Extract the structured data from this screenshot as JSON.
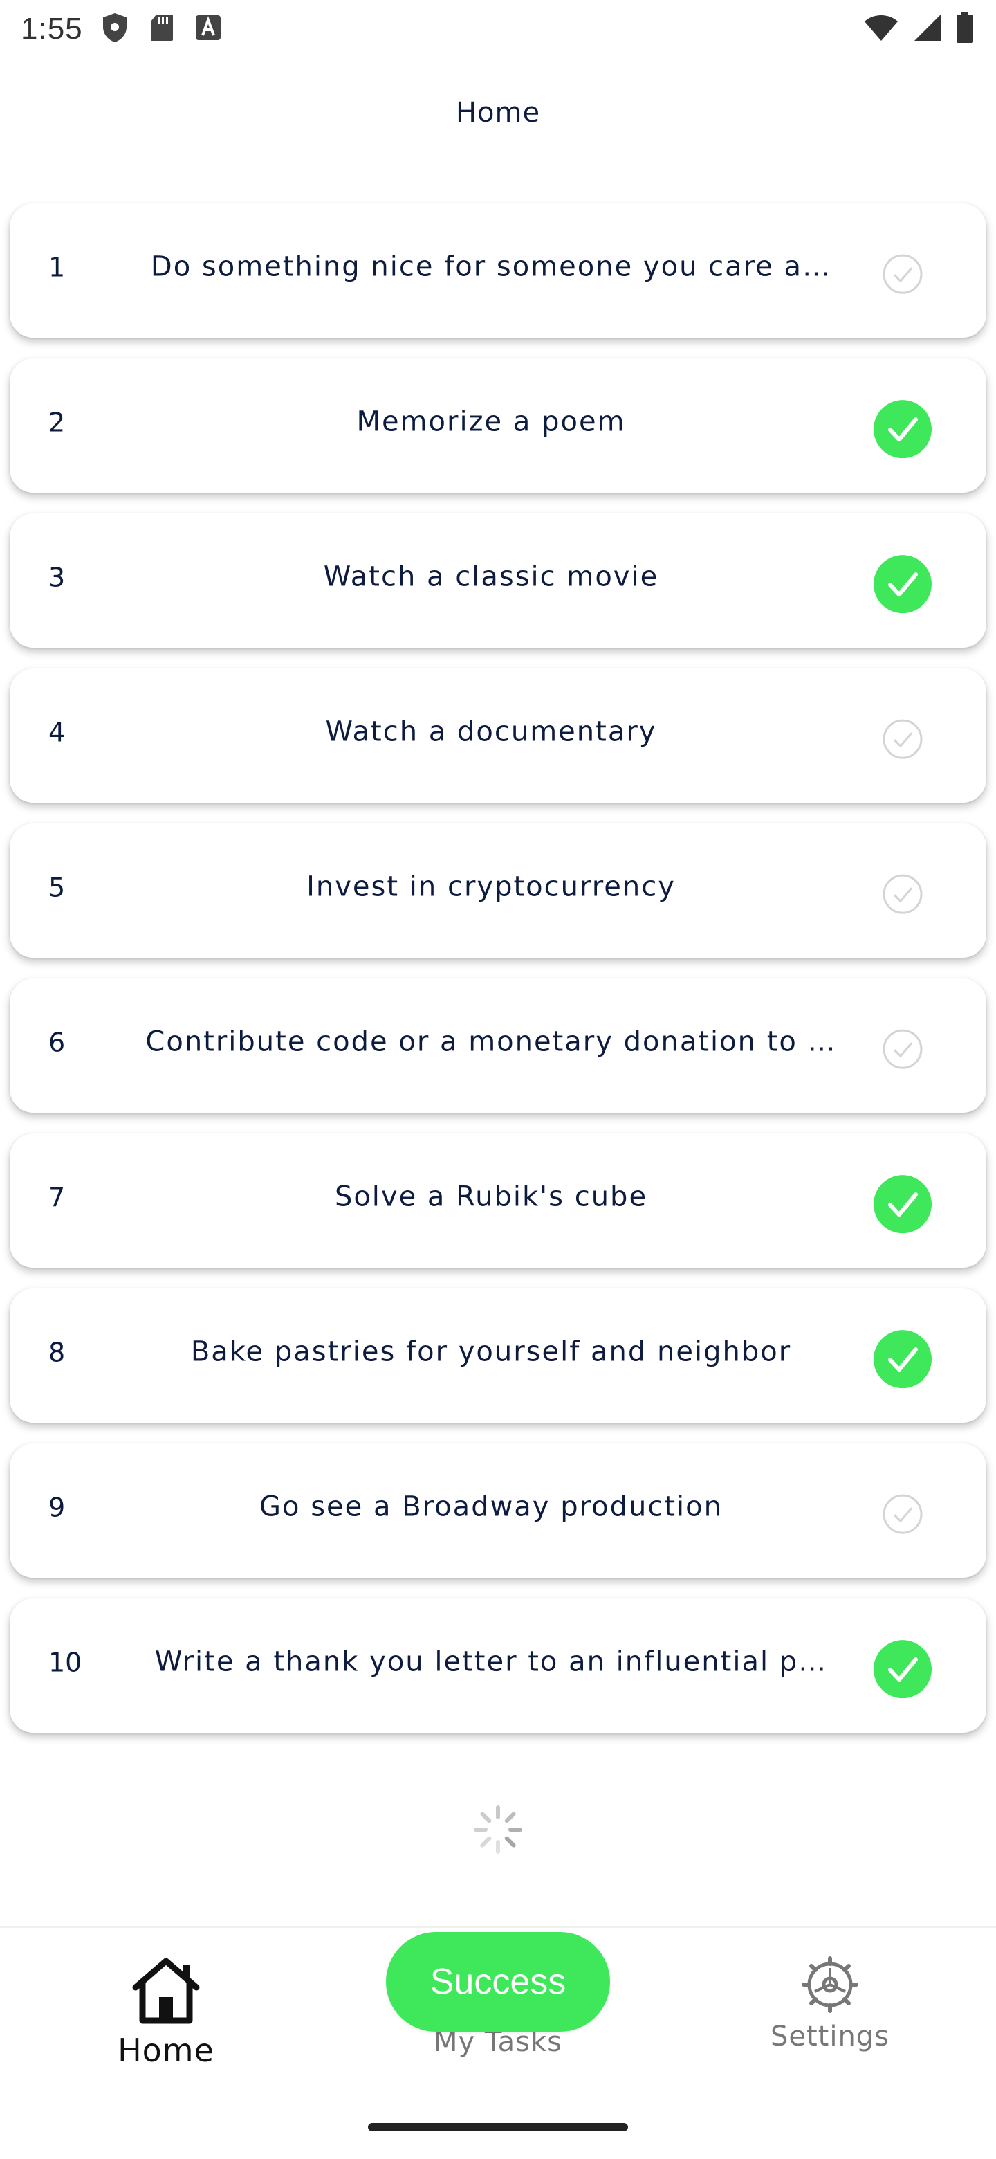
{
  "status_bar": {
    "time": "1:55",
    "icons_left": [
      "shield-icon",
      "sd-card-icon",
      "font-a-icon"
    ],
    "icons_right": [
      "wifi-icon",
      "signal-icon",
      "battery-icon"
    ]
  },
  "header": {
    "title": "Home"
  },
  "tasks": [
    {
      "num": "1",
      "title": "Do something nice for someone you care a…",
      "done": false
    },
    {
      "num": "2",
      "title": "Memorize a poem",
      "done": true
    },
    {
      "num": "3",
      "title": "Watch a classic movie",
      "done": true
    },
    {
      "num": "4",
      "title": "Watch a documentary",
      "done": false
    },
    {
      "num": "5",
      "title": "Invest in cryptocurrency",
      "done": false
    },
    {
      "num": "6",
      "title": "Contribute code or a monetary donation to …",
      "done": false
    },
    {
      "num": "7",
      "title": "Solve a Rubik's cube",
      "done": true
    },
    {
      "num": "8",
      "title": "Bake pastries for yourself and neighbor",
      "done": true
    },
    {
      "num": "9",
      "title": "Go see a Broadway production",
      "done": false
    },
    {
      "num": "10",
      "title": "Write a thank you letter to an influential p…",
      "done": true
    }
  ],
  "nav": {
    "home_label": "Home",
    "tasks_label": "My Tasks",
    "settings_label": "Settings"
  },
  "toast": {
    "text": "Success"
  },
  "colors": {
    "check_green": "#3ee85a",
    "text_navy": "#0d1b3e",
    "unchecked_gray": "#d4d4d4"
  }
}
